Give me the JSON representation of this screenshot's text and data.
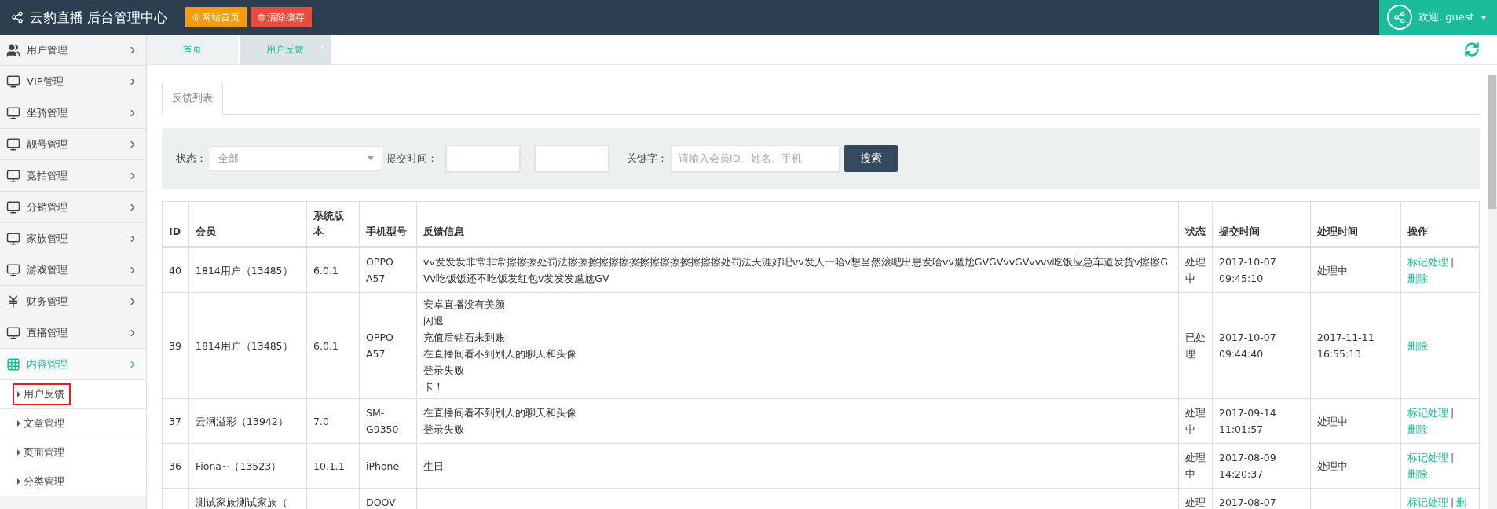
{
  "header": {
    "brand": "云豹直播 后台管理中心",
    "buttons": [
      {
        "label": "网站首页",
        "kind": "home"
      },
      {
        "label": "清除缓存",
        "kind": "clear"
      }
    ],
    "user": "欢迎, guest"
  },
  "sidebar": {
    "items": [
      {
        "label": "用户管理",
        "kind": "users",
        "expanded": false
      },
      {
        "label": "VIP管理",
        "kind": "monitor",
        "expanded": false
      },
      {
        "label": "坐骑管理",
        "kind": "monitor",
        "expanded": false
      },
      {
        "label": "靓号管理",
        "kind": "monitor",
        "expanded": false
      },
      {
        "label": "竞拍管理",
        "kind": "monitor",
        "expanded": false
      },
      {
        "label": "分销管理",
        "kind": "monitor",
        "expanded": false
      },
      {
        "label": "家族管理",
        "kind": "monitor",
        "expanded": false
      },
      {
        "label": "游戏管理",
        "kind": "monitor",
        "expanded": false
      },
      {
        "label": "财务管理",
        "kind": "yen",
        "expanded": false
      },
      {
        "label": "直播管理",
        "kind": "monitor",
        "expanded": false
      },
      {
        "label": "内容管理",
        "kind": "grid",
        "expanded": true,
        "children": [
          {
            "label": "用户反馈",
            "selected": true
          },
          {
            "label": "文章管理",
            "selected": false
          },
          {
            "label": "页面管理",
            "selected": false
          },
          {
            "label": "分类管理",
            "selected": false
          }
        ]
      }
    ]
  },
  "tabs": [
    {
      "label": "首页",
      "selected": false,
      "closable": false
    },
    {
      "label": "用户反馈",
      "selected": true,
      "closable": true
    }
  ],
  "panel_tab": "反馈列表",
  "filter": {
    "status_label": "状态：",
    "status_value": "全部",
    "time_label": "提交时间：",
    "range_separator": "-",
    "keyword_label": "关键字：",
    "keyword_placeholder": "请输入会员ID、姓名、手机",
    "search_button": "搜索"
  },
  "table": {
    "columns": [
      "ID",
      "会员",
      "系统版本",
      "手机型号",
      "反馈信息",
      "状态",
      "提交时间",
      "处理时间",
      "操作"
    ],
    "action_separator": "|",
    "rows": [
      {
        "id": "40",
        "member": "1814用户（13485）",
        "os": "6.0.1",
        "model": "OPPO A57",
        "feedback": [
          "vv发发发非常非常擦擦擦处罚法擦擦擦擦擦擦擦擦擦擦擦擦擦擦擦处罚法天涯好吧vv发人一哈v想当然滚吧出息发哈vv尴尬GVGVvvGVvvvv吃饭应急车道发货v擦擦GVv吃饭饭还不吃饭发红包v发发发尴尬GV"
        ],
        "status": "处理中",
        "submitted": "2017-10-07 09:45:10",
        "processed": "处理中",
        "actions": [
          "标记处理",
          "删除"
        ]
      },
      {
        "id": "39",
        "member": "1814用户（13485）",
        "os": "6.0.1",
        "model": "OPPO A57",
        "feedback": [
          "安卓直播没有美颜",
          "闪退",
          "充值后钻石未到账",
          "在直播间看不到别人的聊天和头像",
          "登录失败",
          "卡！"
        ],
        "status": "已处理",
        "submitted": "2017-10-07 09:44:40",
        "processed": "2017-11-11 16:55:13",
        "actions": [
          "删除"
        ]
      },
      {
        "id": "37",
        "member": "云涧溢彩（13942）",
        "os": "7.0",
        "model": "SM-G9350",
        "feedback": [
          "在直播间看不到别人的聊天和头像",
          "登录失败"
        ],
        "status": "处理中",
        "submitted": "2017-09-14 11:01:57",
        "processed": "处理中",
        "actions": [
          "标记处理",
          "删除"
        ]
      },
      {
        "id": "36",
        "member": "Fiona~（13523）",
        "os": "10.1.1",
        "model": "iPhone",
        "feedback": [
          "生日"
        ],
        "status": "处理中",
        "submitted": "2017-08-09 14:20:37",
        "processed": "处理中",
        "actions": [
          "标记处理",
          "删除"
        ]
      },
      {
        "member": "测试家族测试家族（",
        "model": "DOOV",
        "status": "处理",
        "submitted": "2017-08-07",
        "actions": [
          "标记处理",
          "删"
        ]
      }
    ]
  }
}
